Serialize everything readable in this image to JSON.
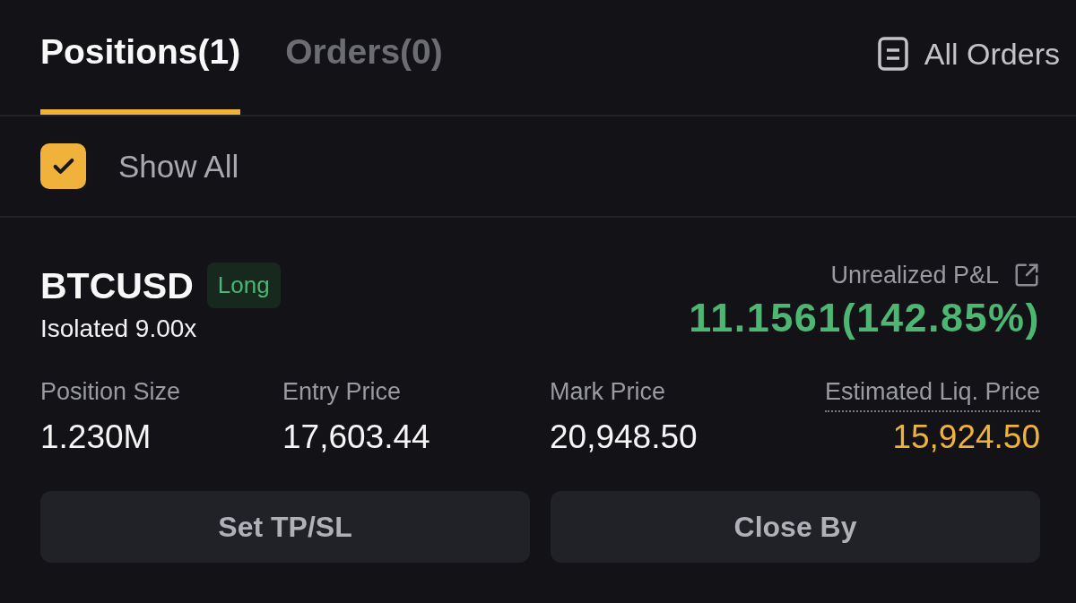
{
  "tabs": [
    {
      "label": "Positions(1)",
      "selected": true
    },
    {
      "label": "Orders(0)",
      "selected": false
    }
  ],
  "all_orders_link": {
    "label": "All Orders"
  },
  "filter": {
    "label": "Show All",
    "checked": true
  },
  "position": {
    "symbol": "BTCUSD",
    "side": {
      "label": "Long",
      "kind": "long"
    },
    "margin_mode": "Isolated 9.00x",
    "pnl": {
      "label": "Unrealized P&L",
      "value": "11.1561(142.85%)",
      "kind": "profit"
    },
    "stats": [
      {
        "label": "Position Size",
        "value": "1.230M",
        "kind": "plain"
      },
      {
        "label": "Entry Price",
        "value": "17,603.44",
        "kind": "plain"
      },
      {
        "label": "Mark Price",
        "value": "20,948.50",
        "kind": "plain"
      },
      {
        "label": "Estimated Liq. Price",
        "value": "15,924.50",
        "kind": "liquidation"
      }
    ],
    "buttons": [
      "Set TP/SL",
      "Close By"
    ]
  }
}
